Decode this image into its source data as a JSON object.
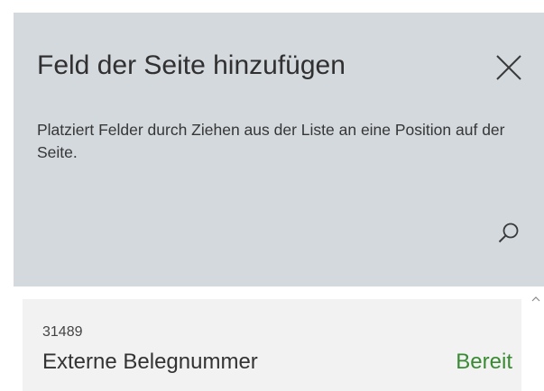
{
  "panel": {
    "title": "Feld der Seite hinzufügen",
    "description": "Platziert Felder durch Ziehen aus der Liste an eine Position auf der Seite.",
    "close_icon": "close-icon",
    "search_icon": "search-icon"
  },
  "fields": [
    {
      "id": "31489",
      "name": "Externe Belegnummer",
      "status": "Bereit",
      "status_color": "#3a8a34"
    }
  ],
  "colors": {
    "panel_background": "#d4d9de",
    "list_item_background": "#f2f2f2",
    "status_ready": "#3a8a34"
  }
}
